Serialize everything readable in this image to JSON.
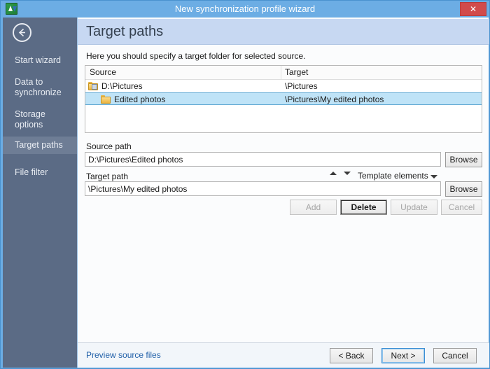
{
  "window": {
    "title": "New synchronization profile wizard",
    "app_icon": "sync-arrows-icon",
    "close_label": "✕"
  },
  "sidebar": {
    "back_icon": "back-arrow-icon",
    "items": [
      {
        "label": "Start wizard",
        "selected": false
      },
      {
        "label": "Data to synchronize",
        "selected": false
      },
      {
        "label": "Storage options",
        "selected": false
      },
      {
        "label": "Target paths",
        "selected": true
      },
      {
        "label": "File filter",
        "selected": false
      }
    ]
  },
  "page": {
    "title": "Target paths",
    "subtitle": "Here you should specify a target folder for selected source."
  },
  "listview": {
    "columns": [
      "Source",
      "Target"
    ],
    "rows": [
      {
        "source": "D:\\Pictures",
        "target": "\\Pictures",
        "icon": "drive-folder-icon",
        "indent": false,
        "selected": false
      },
      {
        "source": "Edited photos",
        "target": "\\Pictures\\My edited photos",
        "icon": "folder-icon",
        "indent": true,
        "selected": true
      }
    ]
  },
  "form": {
    "source_path_label": "Source path",
    "source_path_value": "D:\\Pictures\\Edited photos",
    "source_browse_label": "Browse",
    "target_path_label": "Target path",
    "target_path_value": "\\Pictures\\My edited photos",
    "target_browse_label": "Browse",
    "template_elements_label": "Template elements",
    "move_up_icon": "arrow-up-icon",
    "move_down_icon": "arrow-down-icon",
    "template_caret_icon": "chevron-down-icon",
    "actions": {
      "add_label": "Add",
      "delete_label": "Delete",
      "update_label": "Update",
      "cancel_label": "Cancel"
    }
  },
  "footer": {
    "preview_link": "Preview source files",
    "back_label": "< Back",
    "next_label": "Next >",
    "cancel_label": "Cancel"
  },
  "colors": {
    "titlebar": "#6cade4",
    "sidebar": "#5b6b85",
    "sidebar_selected": "#6e7d95",
    "header_band": "#c7d8f2",
    "selection": "#bfe3f7",
    "link": "#1f5fa8",
    "close": "#d14b4b"
  }
}
